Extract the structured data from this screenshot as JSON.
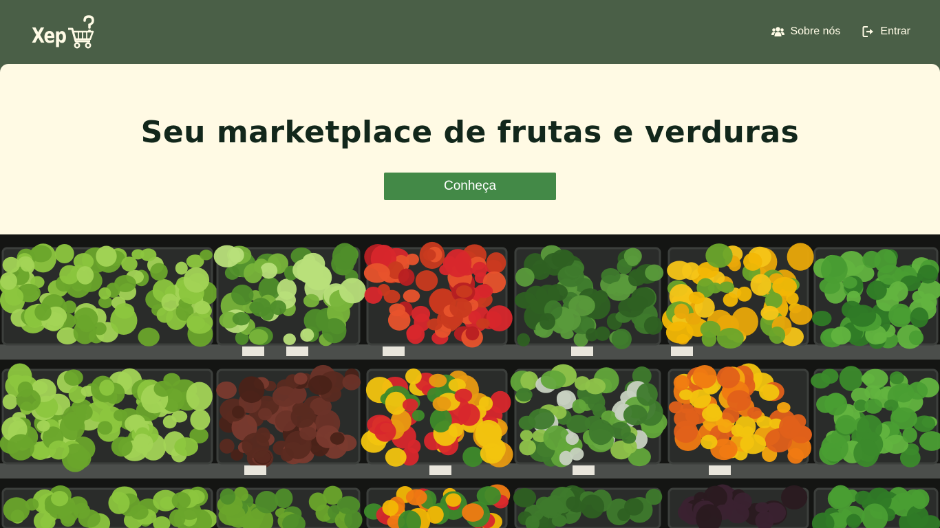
{
  "header": {
    "logo_text": "Xep",
    "logo_icon": "shopping-cart-with-question-mark",
    "nav": [
      {
        "label": "Sobre nós",
        "icon": "users-icon"
      },
      {
        "label": "Entrar",
        "icon": "sign-in-icon"
      }
    ]
  },
  "hero": {
    "title": "Seu marketplace de frutas e verduras",
    "cta_label": "Conheça"
  },
  "colors": {
    "header_bg": "#4a5f47",
    "hero_bg": "#fffae4",
    "title_color": "#12271b",
    "cta_bg": "#438947",
    "light_text": "#fffbe6"
  }
}
